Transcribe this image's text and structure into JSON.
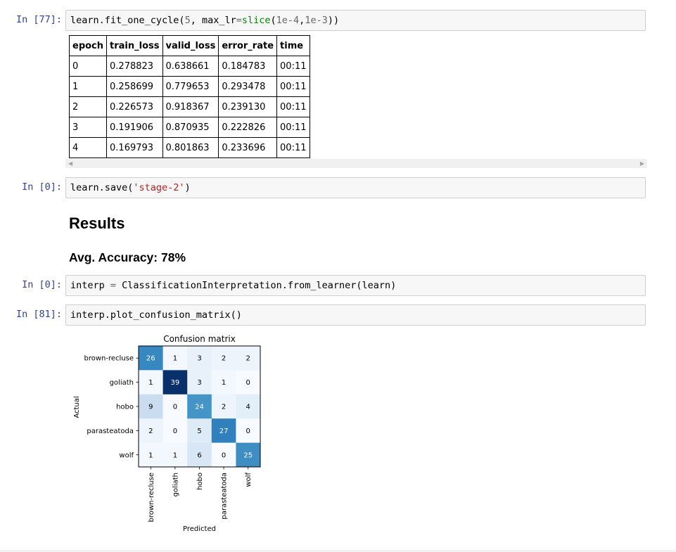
{
  "cells": {
    "fit": {
      "prompt": "In [77]:",
      "code": {
        "a": "learn.fit_one_cycle(",
        "b": "5",
        "c": ", max_lr",
        "d": "=",
        "e": "slice",
        "f": "(",
        "g": "1e-4",
        "h": ",",
        "i": "1e-3",
        "j": "))"
      }
    },
    "save": {
      "prompt": "In [0]:",
      "code": {
        "a": "learn.save(",
        "b": "'stage-2'",
        "c": ")"
      }
    },
    "interp": {
      "prompt": "In [0]:",
      "code": {
        "a": "interp ",
        "b": "=",
        "c": " ClassificationInterpretation.from_learner(learn)"
      }
    },
    "plot": {
      "prompt": "In [81]:",
      "code": "interp.plot_confusion_matrix()"
    }
  },
  "training_table": {
    "headers": [
      "epoch",
      "train_loss",
      "valid_loss",
      "error_rate",
      "time"
    ],
    "rows": [
      [
        "0",
        "0.278823",
        "0.638661",
        "0.184783",
        "00:11"
      ],
      [
        "1",
        "0.258699",
        "0.779653",
        "0.293478",
        "00:11"
      ],
      [
        "2",
        "0.226573",
        "0.918367",
        "0.239130",
        "00:11"
      ],
      [
        "3",
        "0.191906",
        "0.870935",
        "0.222826",
        "00:11"
      ],
      [
        "4",
        "0.169793",
        "0.801863",
        "0.233696",
        "00:11"
      ]
    ]
  },
  "markdown": {
    "heading": "Results",
    "subheading": "Avg. Accuracy: 78%"
  },
  "scrollbar": {
    "left_arrow": "◀",
    "right_arrow": "▶"
  },
  "chart_data": {
    "type": "heatmap",
    "title": "Confusion matrix",
    "xlabel": "Predicted",
    "ylabel": "Actual",
    "x_categories": [
      "brown-recluse",
      "goliath",
      "hobo",
      "parasteatoda",
      "wolf"
    ],
    "y_categories": [
      "brown-recluse",
      "goliath",
      "hobo",
      "parasteatoda",
      "wolf"
    ],
    "values": [
      [
        26,
        1,
        3,
        2,
        2
      ],
      [
        1,
        39,
        3,
        1,
        0
      ],
      [
        9,
        0,
        24,
        2,
        4
      ],
      [
        2,
        0,
        5,
        27,
        0
      ],
      [
        1,
        1,
        6,
        0,
        25
      ]
    ],
    "colormap": "Blues",
    "vmax": 39
  }
}
